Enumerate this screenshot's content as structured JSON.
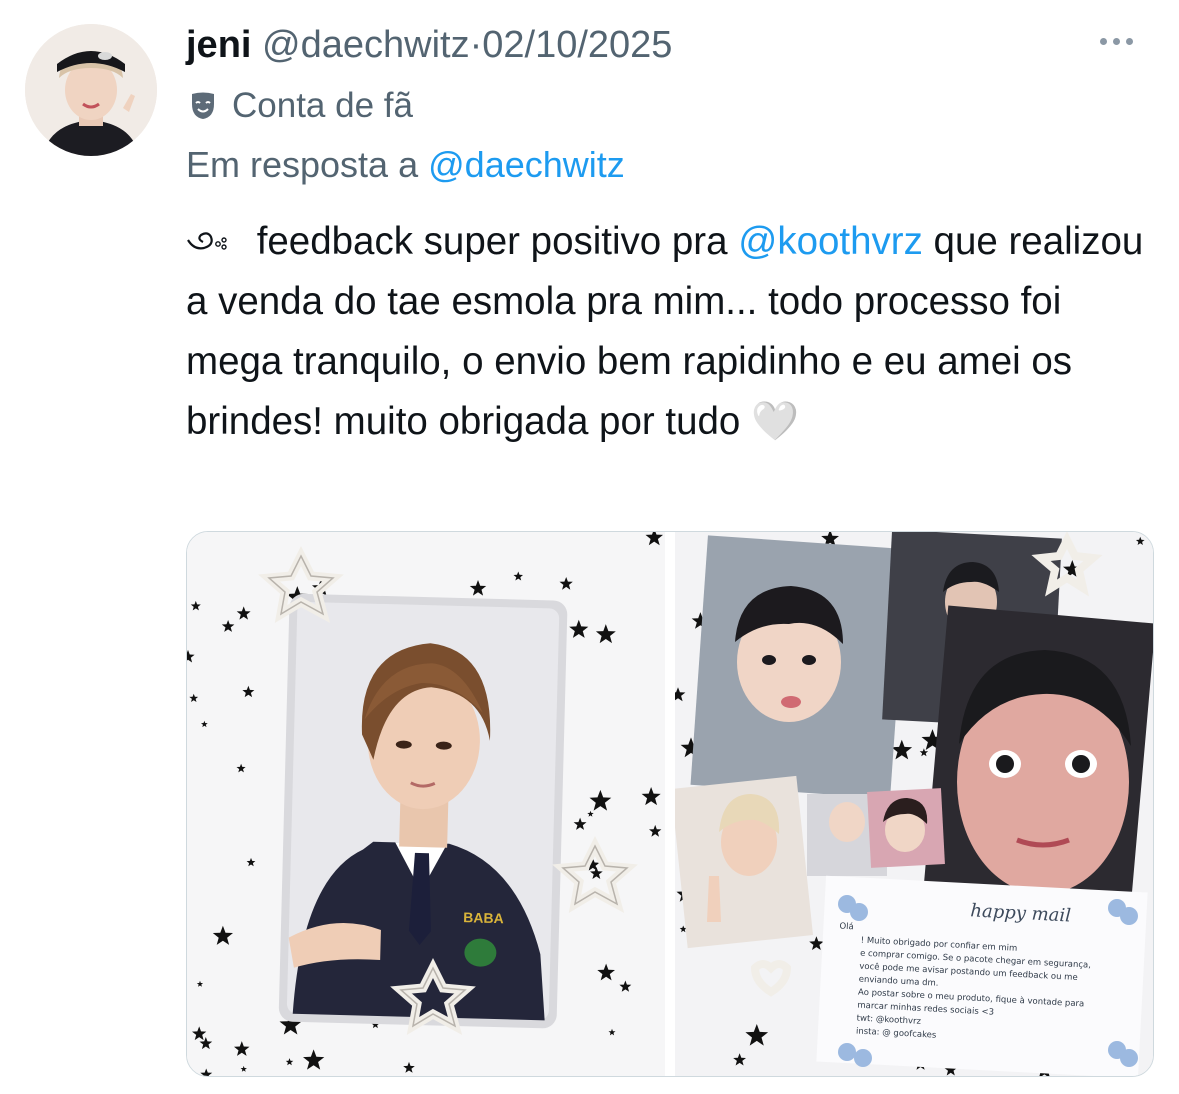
{
  "tweet": {
    "author_name": "jeni",
    "handle": "@daechwitz",
    "separator": "·",
    "date": "02/10/2025",
    "label": "Conta de fã",
    "reply_prefix": "Em resposta a",
    "reply_handle": "@daechwitz",
    "text_before": "feedback super positivo pra",
    "mention": "@koothvrz",
    "text_after": "que realizou a venda do tae esmola pra mim... todo processo foi mega tranquilo, o envio bem rapidinho e eu amei os brindes! muito obrigada por tudo 🤍"
  },
  "note_card": {
    "title": "happy mail",
    "lines": [
      "Olá",
      "! Muito obrigado por confiar em mim",
      "e comprar comigo. Se o pacote chegar em segurança,",
      "você pode me avisar postando um feedback ou me",
      "enviando uma dm.",
      "Ao postar sobre o meu produto, fique à vontade para",
      "marcar minhas redes sociais <3",
      "twt: @koothvrz",
      "insta: @ goofcakes"
    ]
  },
  "photocard_text": "BABA",
  "icons": {
    "more": "more-horizontal-icon",
    "label": "theater-mask-icon",
    "bullet": "swirl-decoration-icon"
  },
  "colors": {
    "link": "#1d9bf0",
    "secondary": "#536471"
  }
}
